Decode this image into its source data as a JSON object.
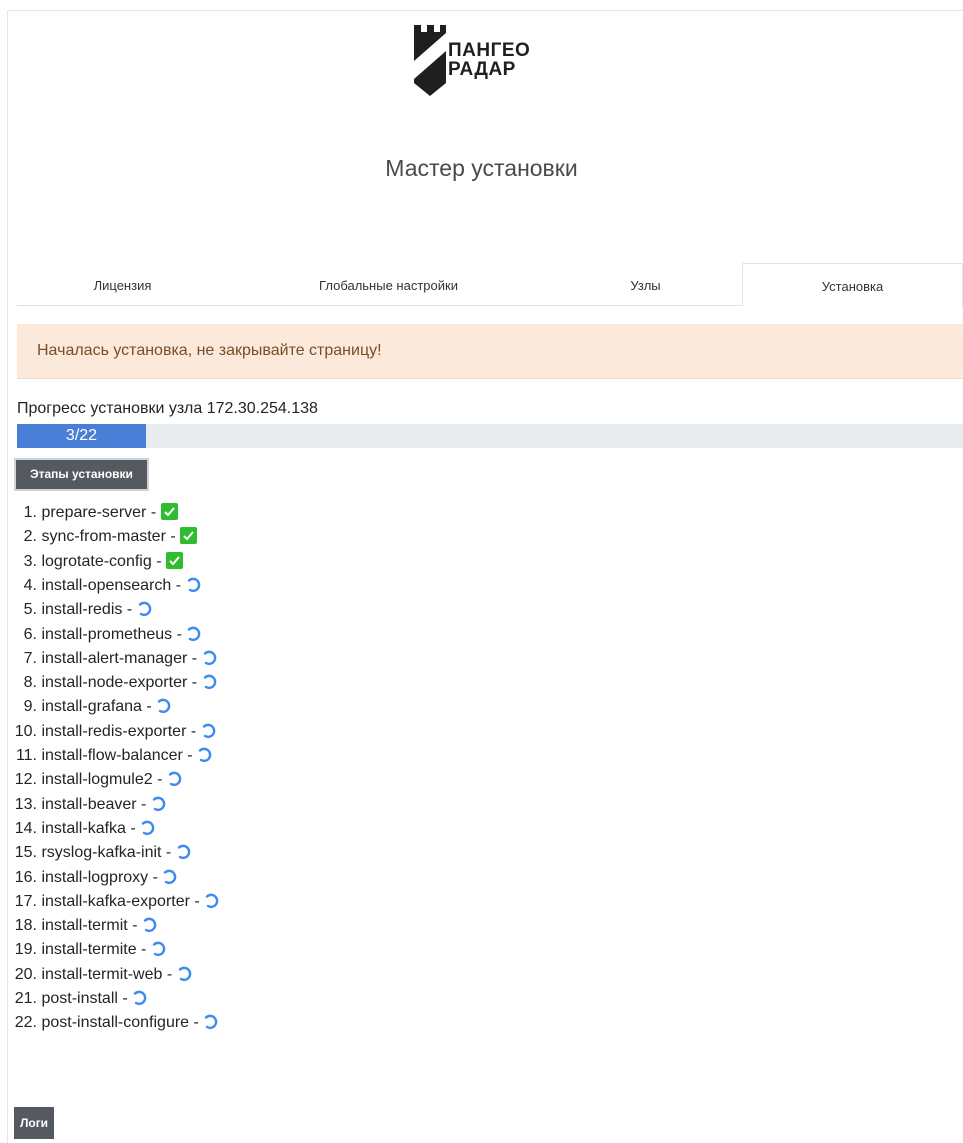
{
  "brand": {
    "line1": "ПАНГЕО",
    "line2": "РАДАР"
  },
  "page_title": "Мастер установки",
  "tabs": [
    {
      "label": "Лицензия",
      "active": false
    },
    {
      "label": "Глобальные настройки",
      "active": false
    },
    {
      "label": "Узлы",
      "active": false
    },
    {
      "label": "Установка",
      "active": true
    }
  ],
  "alert": {
    "text": "Началась установка, не закрывайте страницу!"
  },
  "progress": {
    "label": "Прогресс установки узла 172.30.254.138",
    "text": "3/22",
    "done": 3,
    "total": 22
  },
  "buttons": {
    "stages": "Этапы установки",
    "logs": "Логи"
  },
  "colors": {
    "progress": "#4a7fd8",
    "done": "#2fbd2f",
    "spinner": "#3d8bf0",
    "alert_bg": "#fbe9dc"
  },
  "steps": [
    {
      "num": "1.",
      "name": "prepare-server -",
      "status": "done"
    },
    {
      "num": "2.",
      "name": "sync-from-master -",
      "status": "done"
    },
    {
      "num": "3.",
      "name": "logrotate-config -",
      "status": "done"
    },
    {
      "num": "4.",
      "name": "install-opensearch -",
      "status": "pending"
    },
    {
      "num": "5.",
      "name": "install-redis -",
      "status": "pending"
    },
    {
      "num": "6.",
      "name": "install-prometheus -",
      "status": "pending"
    },
    {
      "num": "7.",
      "name": "install-alert-manager -",
      "status": "pending"
    },
    {
      "num": "8.",
      "name": "install-node-exporter -",
      "status": "pending"
    },
    {
      "num": "9.",
      "name": "install-grafana -",
      "status": "pending"
    },
    {
      "num": "10.",
      "name": "install-redis-exporter -",
      "status": "pending"
    },
    {
      "num": "11.",
      "name": "install-flow-balancer -",
      "status": "pending"
    },
    {
      "num": "12.",
      "name": "install-logmule2 -",
      "status": "pending"
    },
    {
      "num": "13.",
      "name": "install-beaver -",
      "status": "pending"
    },
    {
      "num": "14.",
      "name": "install-kafka -",
      "status": "pending"
    },
    {
      "num": "15.",
      "name": "rsyslog-kafka-init -",
      "status": "pending"
    },
    {
      "num": "16.",
      "name": "install-logproxy -",
      "status": "pending"
    },
    {
      "num": "17.",
      "name": "install-kafka-exporter -",
      "status": "pending"
    },
    {
      "num": "18.",
      "name": "install-termit -",
      "status": "pending"
    },
    {
      "num": "19.",
      "name": "install-termite -",
      "status": "pending"
    },
    {
      "num": "20.",
      "name": "install-termit-web -",
      "status": "pending"
    },
    {
      "num": "21.",
      "name": "post-install -",
      "status": "pending"
    },
    {
      "num": "22.",
      "name": "post-install-configure -",
      "status": "pending"
    }
  ]
}
